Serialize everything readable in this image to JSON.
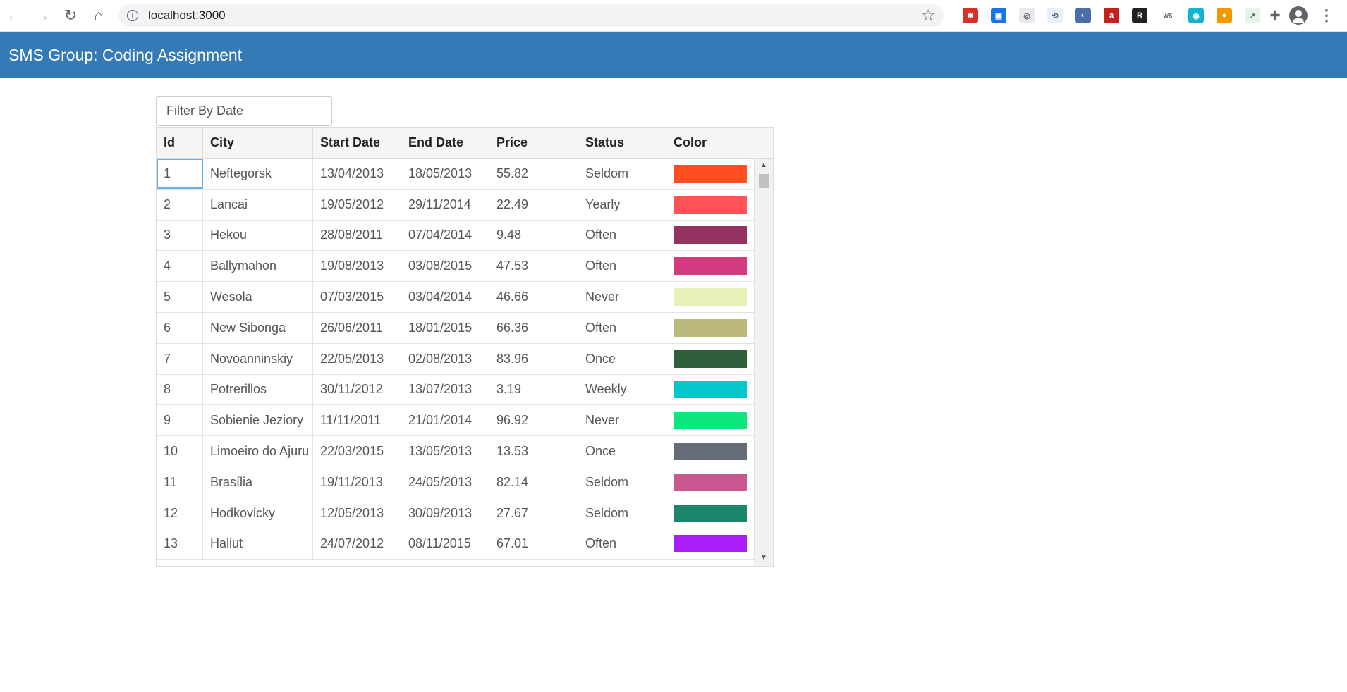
{
  "browser": {
    "url": "localhost:3000"
  },
  "app": {
    "title": "SMS Group: Coding Assignment"
  },
  "filter": {
    "placeholder": "Filter By Date"
  },
  "table": {
    "columns": [
      "Id",
      "City",
      "Start Date",
      "End Date",
      "Price",
      "Status",
      "Color"
    ],
    "rows": [
      {
        "id": "1",
        "city": "Neftegorsk",
        "start": "13/04/2013",
        "end": "18/05/2013",
        "price": "55.82",
        "status": "Seldom",
        "color": "#ff4e20"
      },
      {
        "id": "2",
        "city": "Lancai",
        "start": "19/05/2012",
        "end": "29/11/2014",
        "price": "22.49",
        "status": "Yearly",
        "color": "#ff5357"
      },
      {
        "id": "3",
        "city": "Hekou",
        "start": "28/08/2011",
        "end": "07/04/2014",
        "price": "9.48",
        "status": "Often",
        "color": "#943261"
      },
      {
        "id": "4",
        "city": "Ballymahon",
        "start": "19/08/2013",
        "end": "03/08/2015",
        "price": "47.53",
        "status": "Often",
        "color": "#d23b7f"
      },
      {
        "id": "5",
        "city": "Wesola",
        "start": "07/03/2015",
        "end": "03/04/2014",
        "price": "46.66",
        "status": "Never",
        "color": "#e8f0b8"
      },
      {
        "id": "6",
        "city": "New Sibonga",
        "start": "26/06/2011",
        "end": "18/01/2015",
        "price": "66.36",
        "status": "Often",
        "color": "#bbb87c"
      },
      {
        "id": "7",
        "city": "Novoanninskiy",
        "start": "22/05/2013",
        "end": "02/08/2013",
        "price": "83.96",
        "status": "Once",
        "color": "#2e5f3a"
      },
      {
        "id": "8",
        "city": "Potrerillos",
        "start": "30/11/2012",
        "end": "13/07/2013",
        "price": "3.19",
        "status": "Weekly",
        "color": "#06c5cb"
      },
      {
        "id": "9",
        "city": "Sobienie Jeziory",
        "start": "11/11/2011",
        "end": "21/01/2014",
        "price": "96.92",
        "status": "Never",
        "color": "#0ee57c"
      },
      {
        "id": "10",
        "city": "Limoeiro do Ajuru",
        "start": "22/03/2015",
        "end": "13/05/2013",
        "price": "13.53",
        "status": "Once",
        "color": "#656b79"
      },
      {
        "id": "11",
        "city": "Brasília",
        "start": "19/11/2013",
        "end": "24/05/2013",
        "price": "82.14",
        "status": "Seldom",
        "color": "#c95790"
      },
      {
        "id": "12",
        "city": "Hodkovicky",
        "start": "12/05/2013",
        "end": "30/09/2013",
        "price": "27.67",
        "status": "Seldom",
        "color": "#1b866b"
      },
      {
        "id": "13",
        "city": "Haliut",
        "start": "24/07/2012",
        "end": "08/11/2015",
        "price": "67.01",
        "status": "Often",
        "color": "#a91ef9"
      }
    ]
  },
  "extensions": [
    {
      "name": "ext-red-icon",
      "color": "#d93025",
      "glyph": "✱"
    },
    {
      "name": "ext-blue-icon",
      "color": "#1a73e8",
      "glyph": "▣"
    },
    {
      "name": "ext-dot-icon",
      "color": "#e8eaed",
      "glyph": "◎"
    },
    {
      "name": "ext-share-icon",
      "color": "#e8f0fe",
      "glyph": "⟲"
    },
    {
      "name": "ext-wave-icon",
      "color": "#4a6fa5",
      "glyph": "◐"
    },
    {
      "name": "ext-a-icon",
      "color": "#c5221f",
      "glyph": "a"
    },
    {
      "name": "ext-r-icon",
      "color": "#202124",
      "glyph": "R"
    },
    {
      "name": "ext-ws-client-icon",
      "color": "#ffffff",
      "glyph": "WS"
    },
    {
      "name": "ext-teal-icon",
      "color": "#12b5cb",
      "glyph": "◉"
    },
    {
      "name": "ext-color-icon",
      "color": "#f29900",
      "glyph": "●"
    },
    {
      "name": "ext-green-icon",
      "color": "#e6f4ea",
      "glyph": "↗"
    }
  ]
}
